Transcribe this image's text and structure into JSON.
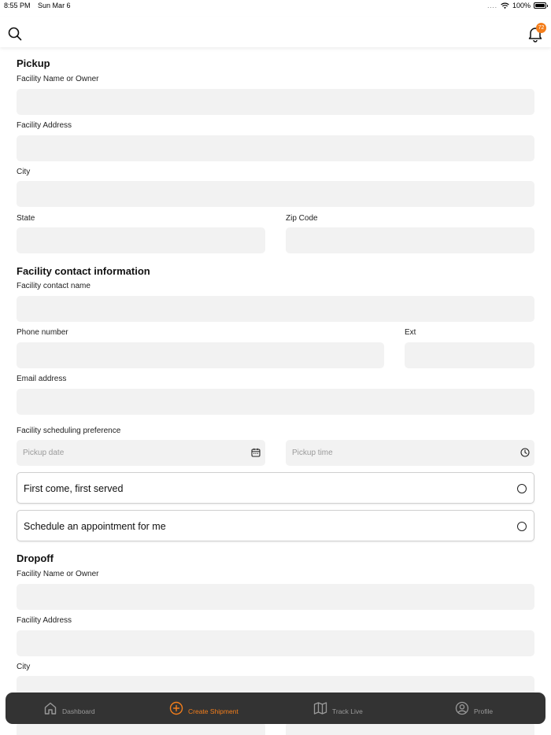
{
  "status_bar": {
    "time": "8:55 PM",
    "date": "Sun Mar 6",
    "signal_dots": "....",
    "battery": "100%"
  },
  "header": {
    "notification_count": "72"
  },
  "pickup": {
    "title": "Pickup",
    "facility_name_label": "Facility Name or Owner",
    "facility_address_label": "Facility Address",
    "city_label": "City",
    "state_label": "State",
    "zip_label": "Zip Code"
  },
  "contact": {
    "title": "Facility contact information",
    "contact_name_label": "Facility contact name",
    "phone_label": "Phone number",
    "ext_label": "Ext",
    "email_label": "Email address"
  },
  "scheduling": {
    "label": "Facility scheduling preference",
    "pickup_date_placeholder": "Pickup date",
    "pickup_time_placeholder": "Pickup time",
    "options": [
      "First come, first served",
      "Schedule an appointment for me"
    ]
  },
  "dropoff": {
    "title": "Dropoff",
    "facility_name_label": "Facility Name or Owner",
    "facility_address_label": "Facility Address",
    "city_label": "City"
  },
  "tabs": [
    {
      "label": "Dashboard",
      "icon": "home-icon",
      "active": false
    },
    {
      "label": "Create Shipment",
      "icon": "plus-circle-icon",
      "active": true
    },
    {
      "label": "Track Live",
      "icon": "map-icon",
      "active": false
    },
    {
      "label": "Profile",
      "icon": "user-circle-icon",
      "active": false
    }
  ],
  "colors": {
    "accent": "#f47e1b",
    "field_bg": "#f2f2f2",
    "tab_bar_bg": "#333333",
    "inactive_tab": "#9a9a9a"
  }
}
